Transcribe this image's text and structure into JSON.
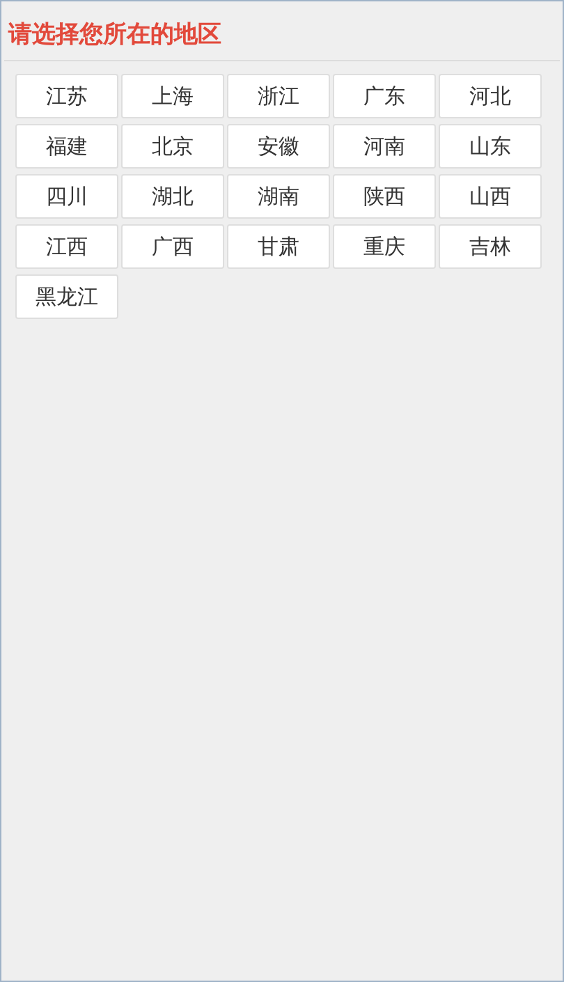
{
  "title": "请选择您所在的地区",
  "regions": [
    "江苏",
    "上海",
    "浙江",
    "广东",
    "河北",
    "福建",
    "北京",
    "安徽",
    "河南",
    "山东",
    "四川",
    "湖北",
    "湖南",
    "陕西",
    "山西",
    "江西",
    "广西",
    "甘肃",
    "重庆",
    "吉林",
    "黑龙江"
  ]
}
